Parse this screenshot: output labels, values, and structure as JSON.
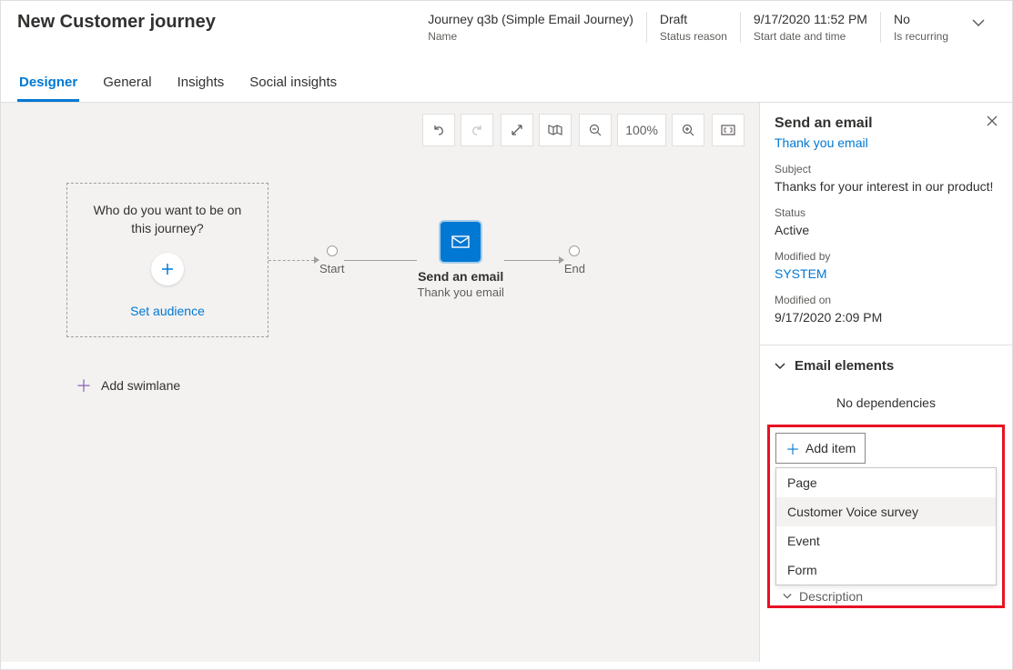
{
  "header": {
    "title": "New Customer journey",
    "meta": [
      {
        "value": "Journey q3b (Simple Email Journey)",
        "label": "Name"
      },
      {
        "value": "Draft",
        "label": "Status reason"
      },
      {
        "value": "9/17/2020 11:52 PM",
        "label": "Start date and time"
      },
      {
        "value": "No",
        "label": "Is recurring"
      }
    ]
  },
  "tabs": [
    "Designer",
    "General",
    "Insights",
    "Social insights"
  ],
  "canvas": {
    "zoom": "100%",
    "audience_question": "Who do you want to be on this journey?",
    "set_audience": "Set audience",
    "start_label": "Start",
    "end_label": "End",
    "email_node_title": "Send an email",
    "email_node_subtitle": "Thank you email",
    "add_swimlane": "Add swimlane"
  },
  "panel": {
    "title": "Send an email",
    "link": "Thank you email",
    "fields": [
      {
        "label": "Subject",
        "value": "Thanks for your interest in our product!"
      },
      {
        "label": "Status",
        "value": "Active"
      },
      {
        "label": "Modified by",
        "value": "SYSTEM",
        "link": true
      },
      {
        "label": "Modified on",
        "value": "9/17/2020 2:09 PM"
      }
    ],
    "section_title": "Email elements",
    "no_deps": "No dependencies",
    "add_item_label": "Add item",
    "dropdown": [
      "Page",
      "Customer Voice survey",
      "Event",
      "Form"
    ],
    "description_label": "Description"
  }
}
